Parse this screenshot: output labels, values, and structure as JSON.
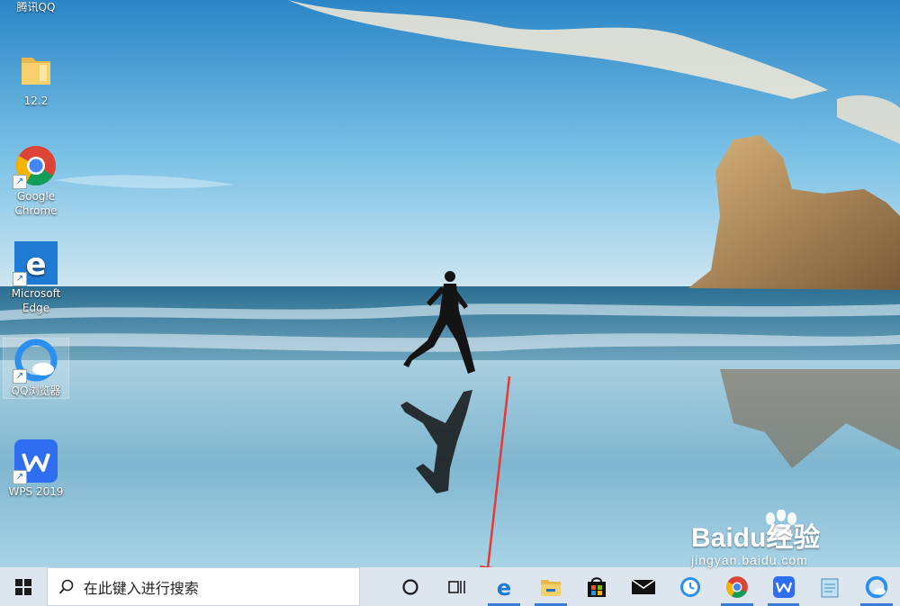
{
  "desktop": {
    "icons": [
      {
        "label": "腾讯QQ"
      },
      {
        "label": "12.2"
      },
      {
        "label": "Google Chrome"
      },
      {
        "label": "Microsoft Edge"
      },
      {
        "label": "QQ浏览器"
      },
      {
        "label": "WPS 2019"
      }
    ]
  },
  "taskbar": {
    "search_placeholder": "在此键入进行搜索",
    "pinned": [
      "edge-icon",
      "file-explorer-icon",
      "store-icon",
      "mail-icon",
      "clock-icon",
      "chrome-icon",
      "wps-icon",
      "notepad-icon",
      "qq-browser-icon"
    ]
  },
  "watermark": {
    "brand": "Baidu经验",
    "url": "jingyan.baidu.com"
  },
  "colors": {
    "taskbar_bg": "#dde6ee",
    "accent": "#3a7bd5",
    "arrow": "#e53935"
  }
}
